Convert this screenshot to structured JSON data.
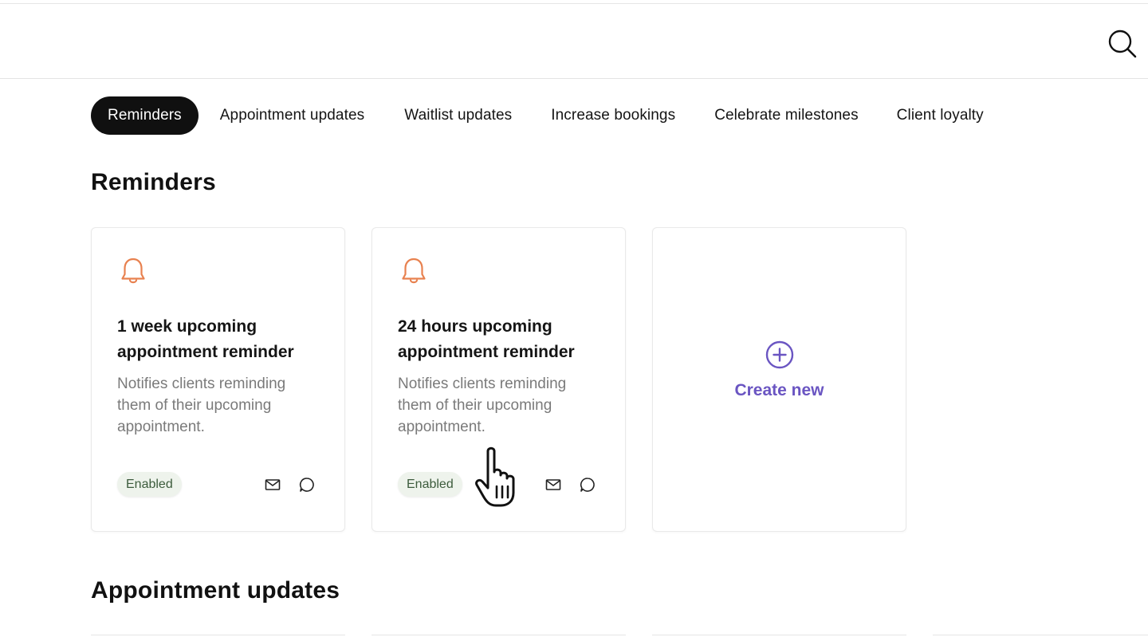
{
  "tabs": [
    {
      "label": "Reminders",
      "active": true
    },
    {
      "label": "Appointment updates",
      "active": false
    },
    {
      "label": "Waitlist updates",
      "active": false
    },
    {
      "label": "Increase bookings",
      "active": false
    },
    {
      "label": "Celebrate milestones",
      "active": false
    },
    {
      "label": "Client loyalty",
      "active": false
    }
  ],
  "sections": {
    "reminders_title": "Reminders",
    "appointment_updates_title": "Appointment updates"
  },
  "cards": [
    {
      "title": "1 week upcoming appointment reminder",
      "description": "Notifies clients reminding them of their upcoming appointment.",
      "status": "Enabled",
      "icon": "bell-icon",
      "channels": [
        "email-icon",
        "chat-icon"
      ]
    },
    {
      "title": "24 hours upcoming appointment reminder",
      "description": "Notifies clients reminding them of their upcoming appointment.",
      "status": "Enabled",
      "icon": "bell-icon",
      "channels": [
        "email-icon",
        "chat-icon"
      ]
    }
  ],
  "create_card": {
    "label": "Create new",
    "icon": "plus-circle-icon"
  },
  "colors": {
    "accent_purple": "#6a55c2",
    "bell_orange": "#e8814f",
    "active_tab_bg": "#101010",
    "badge_bg": "#eef3ec",
    "badge_text": "#3c5b3c"
  }
}
